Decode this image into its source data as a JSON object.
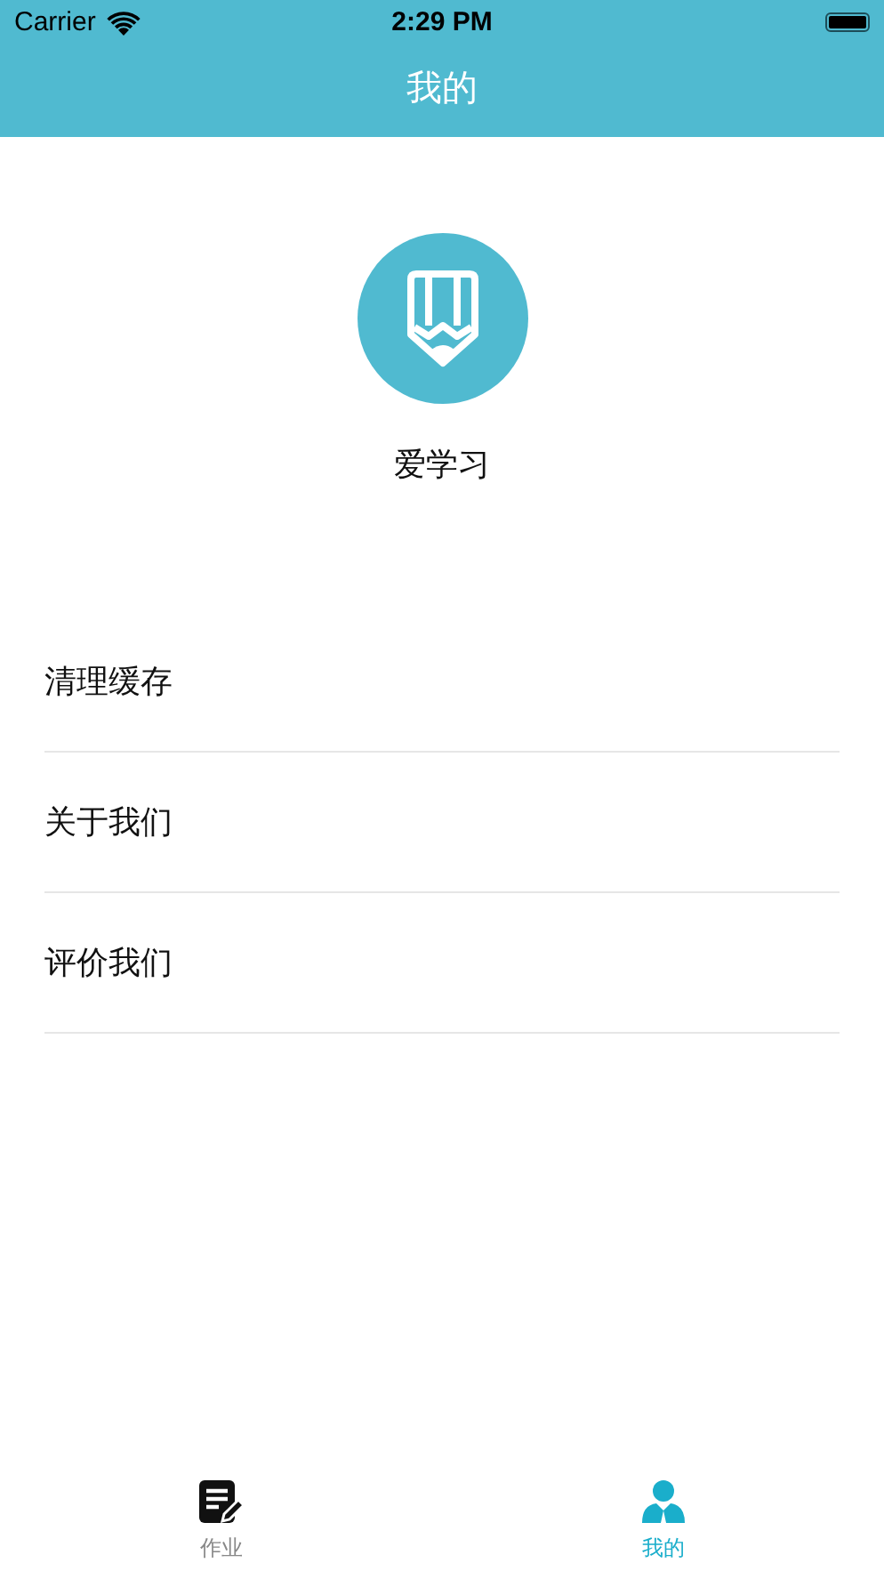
{
  "status_bar": {
    "carrier": "Carrier",
    "time": "2:29 PM"
  },
  "nav_bar": {
    "title": "我的"
  },
  "profile": {
    "name": "爱学习"
  },
  "menu": [
    {
      "label": "清理缓存"
    },
    {
      "label": "关于我们"
    },
    {
      "label": "评价我们"
    }
  ],
  "tab_bar": [
    {
      "kind": "homework",
      "label": "作业",
      "selected": false
    },
    {
      "kind": "profile",
      "label": "我的",
      "selected": true
    }
  ]
}
